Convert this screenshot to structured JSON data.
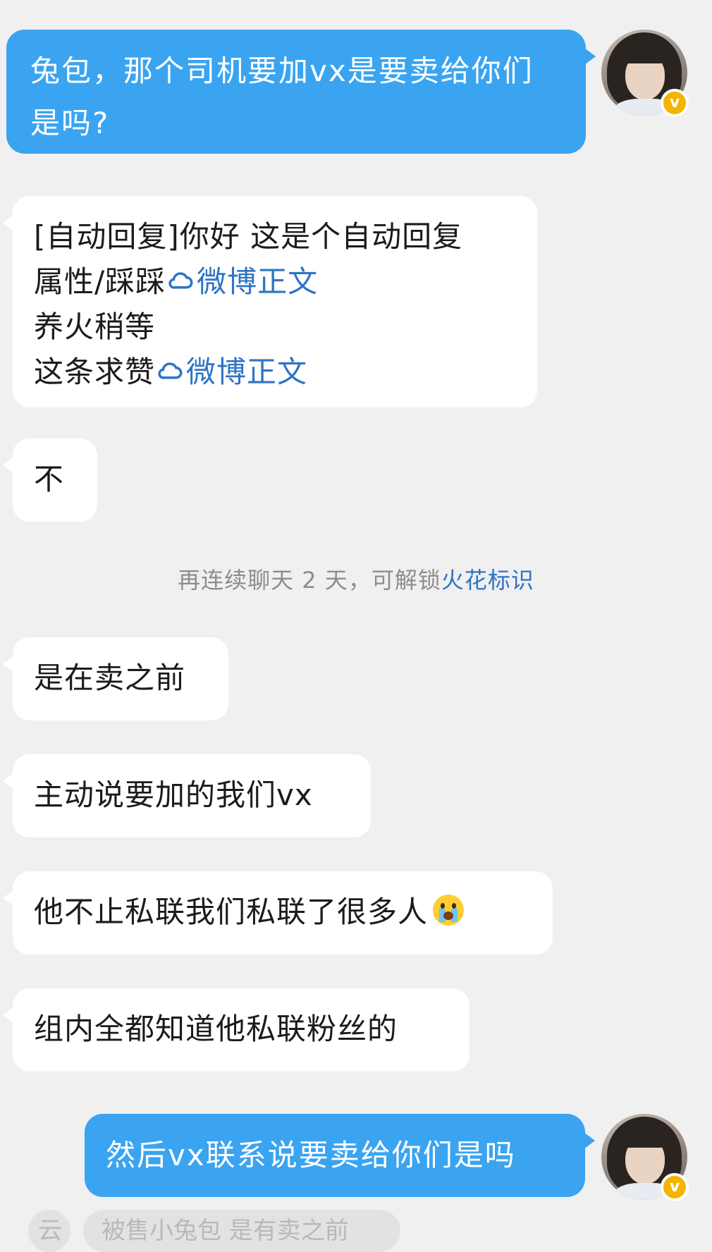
{
  "messages": {
    "sent_1": "兔包，那个司机要加vx是要卖给你们是吗?",
    "recv_auto": {
      "line1": "[自动回复]你好 这是个自动回复",
      "line2_prefix": "属性/踩踩",
      "line2_link": "微博正文",
      "line3": "养火稍等",
      "line4_prefix": "这条求赞",
      "line4_link": "微博正文"
    },
    "recv_2": "不",
    "system_note": {
      "prefix": "再连续聊天 2 天，可解锁",
      "link": "火花标识"
    },
    "recv_3": "是在卖之前",
    "recv_4": "主动说要加的我们vx",
    "recv_5": "他不止私联我们私联了很多人",
    "recv_6": "组内全都知道他私联粉丝的",
    "sent_2": "然后vx联系说要卖给你们是吗"
  },
  "cutoff": {
    "left_pill": "云",
    "right_pill": "被售小兔包 是有卖之前"
  },
  "avatar": {
    "badge": "v"
  },
  "colors": {
    "sent_bubble": "#3aa4f1",
    "received_bubble": "#ffffff",
    "background": "#f0f0f0",
    "link": "#2e74c5",
    "verified_badge": "#f4b400"
  },
  "icons": {
    "weibo_link": "weibo-cloud-icon",
    "cry_emoji": "crying-face-emoji",
    "verified": "verified-badge-icon"
  }
}
